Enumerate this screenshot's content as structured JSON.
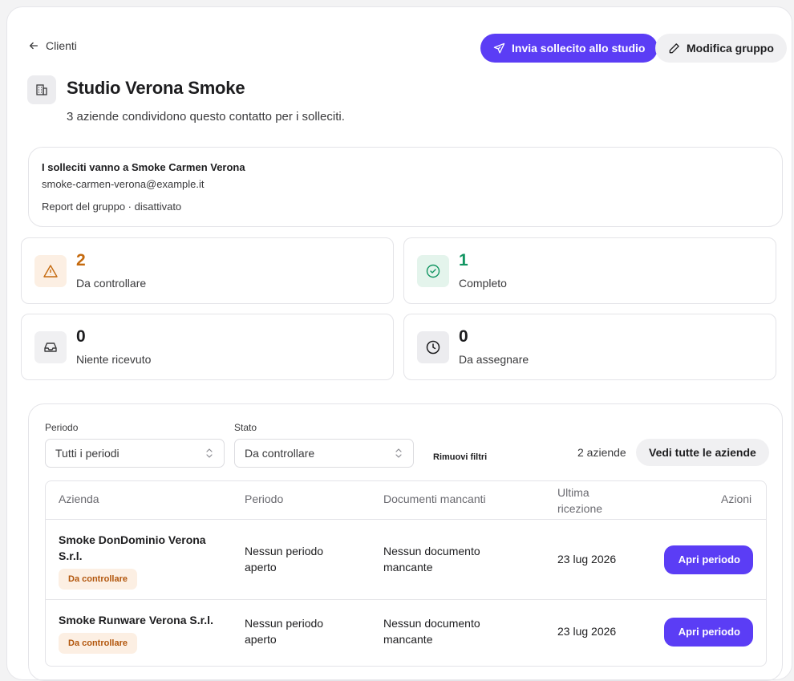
{
  "header": {
    "back_label": "Clienti",
    "remind_button": "Invia sollecito allo studio",
    "edit_button": "Modifica gruppo",
    "title": "Studio Verona Smoke",
    "subtitle": "3 aziende condividono questo contatto per i solleciti."
  },
  "contact": {
    "recipient": "I solleciti vanno a Smoke Carmen Verona",
    "email": "smoke-carmen-verona@example.it",
    "report": "Report del gruppo · disattivato"
  },
  "stats": [
    {
      "value": "2",
      "label": "Da controllare",
      "color": "#c56a0f",
      "icon": "warning-icon"
    },
    {
      "value": "1",
      "label": "Completo",
      "color": "#129562",
      "icon": "check-circle-icon"
    },
    {
      "value": "0",
      "label": "Niente ricevuto",
      "color": "#1d1d1f",
      "icon": "inbox-icon"
    },
    {
      "value": "0",
      "label": "Da assegnare",
      "color": "#1d1d1f",
      "icon": "clock-icon"
    }
  ],
  "filters": {
    "period_label": "Periodo",
    "period_value": "Tutti i periodi",
    "status_label": "Stato",
    "status_value": "Da controllare",
    "clear_label": "Rimuovi filtri",
    "count_label": "2 aziende",
    "view_all": "Vedi tutte le aziende"
  },
  "table": {
    "columns": [
      "Azienda",
      "Periodo",
      "Documenti mancanti",
      "Ultima ricezione",
      "Azioni"
    ],
    "rows": [
      {
        "company": "Smoke DonDominio Verona S.r.l.",
        "status": "Da controllare",
        "period": "Nessun periodo aperto",
        "missing": "Nessun documento mancante",
        "last": "23 lug 2026",
        "action": "Apri periodo"
      },
      {
        "company": "Smoke Runware Verona S.r.l.",
        "status": "Da controllare",
        "period": "Nessun periodo aperto",
        "missing": "Nessun documento mancante",
        "last": "23 lug 2026",
        "action": "Apri periodo"
      }
    ]
  },
  "colors": {
    "accent": "#5b3df5",
    "warning": "#c56a0f",
    "success": "#129562"
  }
}
